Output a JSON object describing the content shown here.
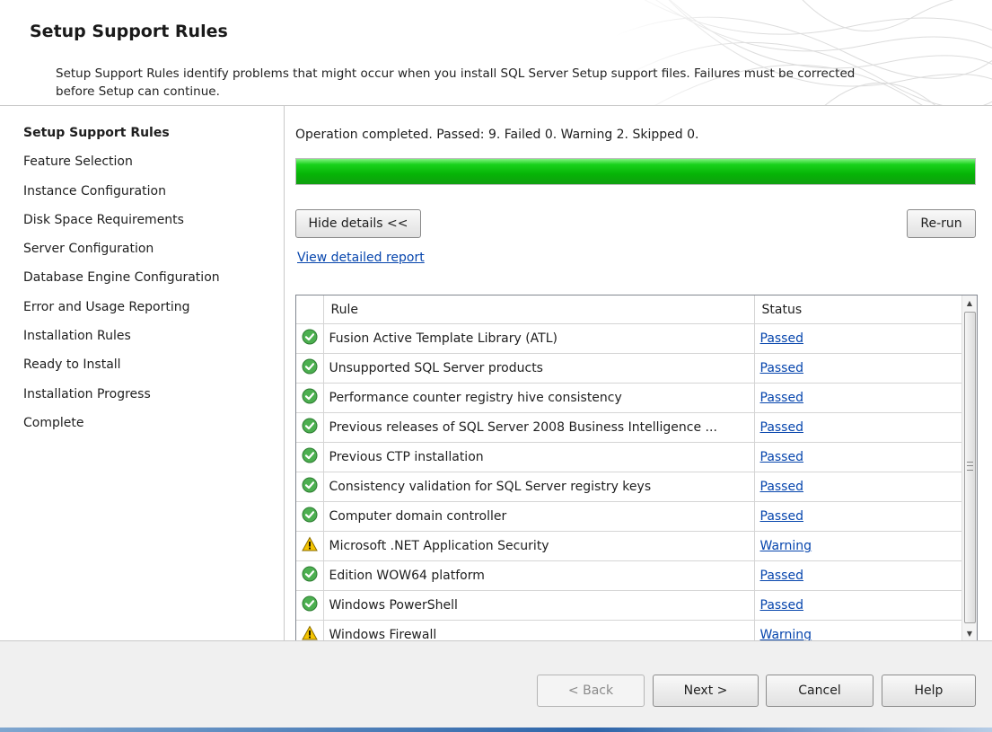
{
  "header": {
    "title": "Setup Support Rules",
    "description": "Setup Support Rules identify problems that might occur when you install SQL Server Setup support files. Failures must be corrected before Setup can continue."
  },
  "sidebar": {
    "items": [
      {
        "label": "Setup Support Rules",
        "active": true
      },
      {
        "label": "Feature Selection"
      },
      {
        "label": "Instance Configuration"
      },
      {
        "label": "Disk Space Requirements"
      },
      {
        "label": "Server Configuration"
      },
      {
        "label": "Database Engine Configuration"
      },
      {
        "label": "Error and Usage Reporting"
      },
      {
        "label": "Installation Rules"
      },
      {
        "label": "Ready to Install"
      },
      {
        "label": "Installation Progress"
      },
      {
        "label": "Complete"
      }
    ]
  },
  "main": {
    "status_text": "Operation completed. Passed: 9.   Failed 0.   Warning 2.   Skipped 0.",
    "progress": 1.0,
    "hide_details_label": "Hide details <<",
    "rerun_label": "Re-run",
    "report_link": "View detailed report",
    "table": {
      "columns": [
        "Rule",
        "Status"
      ],
      "rows": [
        {
          "icon": "passed-check-icon",
          "rule": "Fusion Active Template Library (ATL)",
          "status": "Passed"
        },
        {
          "icon": "passed-check-icon",
          "rule": "Unsupported SQL Server products",
          "status": "Passed"
        },
        {
          "icon": "passed-check-icon",
          "rule": "Performance counter registry hive consistency",
          "status": "Passed"
        },
        {
          "icon": "passed-check-icon",
          "rule": "Previous releases of SQL Server 2008 Business Intelligence ...",
          "status": "Passed"
        },
        {
          "icon": "passed-check-icon",
          "rule": "Previous CTP installation",
          "status": "Passed"
        },
        {
          "icon": "passed-check-icon",
          "rule": "Consistency validation for SQL Server registry keys",
          "status": "Passed"
        },
        {
          "icon": "passed-check-icon",
          "rule": "Computer domain controller",
          "status": "Passed"
        },
        {
          "icon": "warning-triangle-icon",
          "rule": "Microsoft .NET Application Security",
          "status": "Warning"
        },
        {
          "icon": "passed-check-icon",
          "rule": "Edition WOW64 platform",
          "status": "Passed"
        },
        {
          "icon": "passed-check-icon",
          "rule": "Windows PowerShell",
          "status": "Passed"
        },
        {
          "icon": "warning-triangle-icon",
          "rule": "Windows Firewall",
          "status": "Warning"
        }
      ]
    }
  },
  "footer": {
    "back_label": "< Back",
    "next_label": "Next >",
    "cancel_label": "Cancel",
    "help_label": "Help"
  },
  "colors": {
    "progress_green": "#06b406",
    "link_blue": "#0645ad",
    "check_green": "#4caf50",
    "warning_yellow": "#f5c400"
  }
}
